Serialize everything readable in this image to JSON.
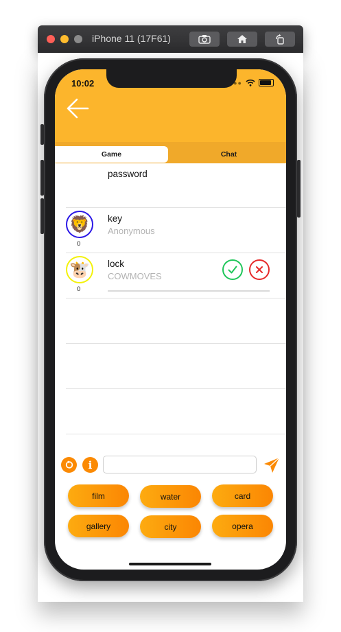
{
  "simulator": {
    "title": "iPhone 11 (17F61)",
    "buttons": [
      "screenshot-icon",
      "home-icon",
      "rotate-icon"
    ]
  },
  "status_bar": {
    "time": "10:02"
  },
  "tabs": [
    {
      "label": "Game",
      "selected": true
    },
    {
      "label": "Chat",
      "selected": false
    }
  ],
  "rows": [
    {
      "word": "password",
      "author": ""
    },
    {
      "word": "key",
      "author": "Anonymous",
      "avatar": "lion-emoji-icon",
      "avatar_glyph": "🦁",
      "ring_color": "#2b18e6",
      "score": "0"
    },
    {
      "word": "lock",
      "author": "COWMOVES",
      "avatar": "cow-emoji-icon",
      "avatar_glyph": "🐮",
      "ring_color": "#f3f20b",
      "score": "0",
      "actions": [
        "accept-icon",
        "reject-icon"
      ]
    }
  ],
  "input": {
    "value": "",
    "placeholder": ""
  },
  "word_buttons": [
    "film",
    "water",
    "card",
    "gallery",
    "city",
    "opera"
  ],
  "colors": {
    "header": "#fcb52c",
    "accent": "#fb8a04",
    "accept": "#1fc65a",
    "reject": "#e62a2a"
  }
}
